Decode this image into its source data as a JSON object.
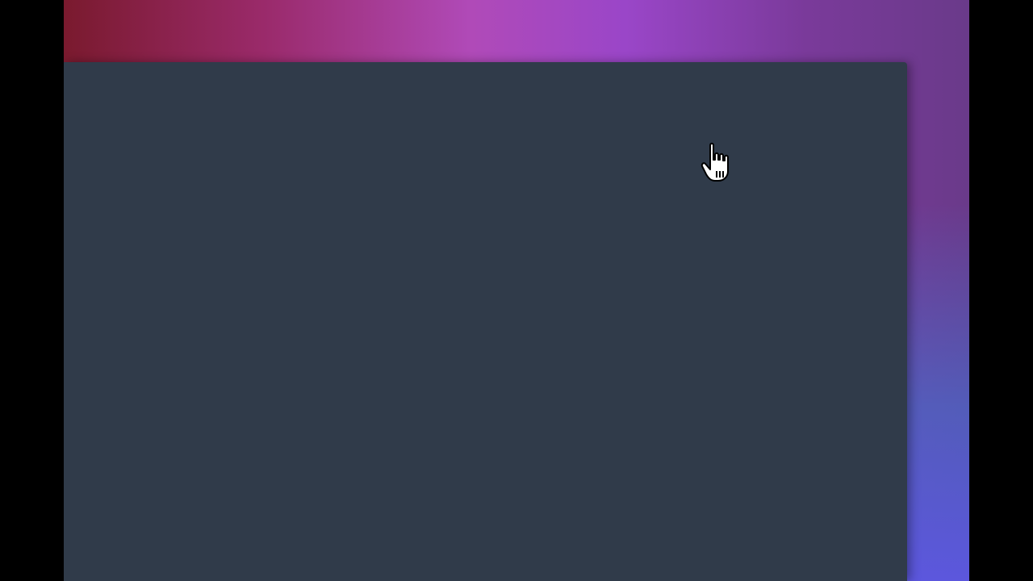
{
  "screen": {
    "background_gradient": [
      "#7a1a2e",
      "#9a2a6a",
      "#b04ab8",
      "#9a46c8",
      "#6a3a8a",
      "#5a5ad8"
    ],
    "letterbox_color": "#000000"
  },
  "window": {
    "background_color": "#303b4a",
    "content": ""
  },
  "cursor": {
    "icon": "hand-pointer-icon"
  }
}
